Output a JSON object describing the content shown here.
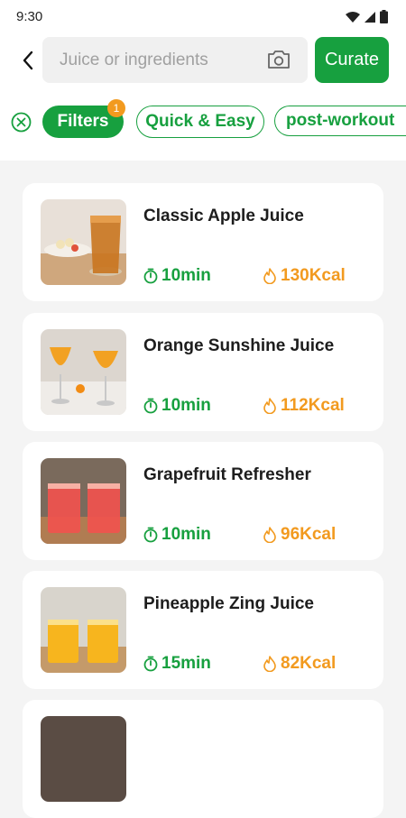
{
  "status": {
    "time": "9:30"
  },
  "search": {
    "placeholder": "Juice or ingredients"
  },
  "header": {
    "curate_label": "Curate"
  },
  "filters": {
    "label": "Filters",
    "badge": "1",
    "chips": [
      "Quick & Easy",
      "post-workout"
    ]
  },
  "colors": {
    "accent": "#17a03f",
    "calorie": "#f29a1f",
    "badge": "#f29a1f"
  },
  "recipes": [
    {
      "title": "Classic Apple Juice",
      "time": "10min",
      "calories": "130Kcal"
    },
    {
      "title": "Orange Sunshine Juice",
      "time": "10min",
      "calories": "112Kcal"
    },
    {
      "title": "Grapefruit Refresher",
      "time": "10min",
      "calories": "96Kcal"
    },
    {
      "title": "Pineapple Zing Juice",
      "time": "15min",
      "calories": "82Kcal"
    }
  ]
}
